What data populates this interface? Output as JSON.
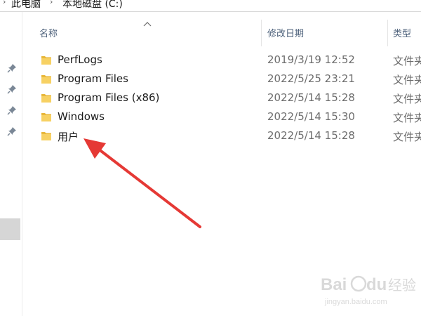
{
  "breadcrumb": {
    "items": [
      "此电脑",
      "本地磁盘 (C:)"
    ]
  },
  "columns": {
    "name": "名称",
    "modified": "修改日期",
    "type": "类型"
  },
  "files": [
    {
      "name": "PerfLogs",
      "date": "2019/3/19 12:52",
      "type": "文件夹"
    },
    {
      "name": "Program Files",
      "date": "2022/5/25 23:21",
      "type": "文件夹"
    },
    {
      "name": "Program Files (x86)",
      "date": "2022/5/14 15:28",
      "type": "文件夹"
    },
    {
      "name": "Windows",
      "date": "2022/5/14 15:30",
      "type": "文件夹"
    },
    {
      "name": "用户",
      "date": "2022/5/14 15:28",
      "type": "文件夹"
    }
  ],
  "icons": {
    "folder": "folder-icon",
    "pin": "pin-icon",
    "sort": "sort-ascending-icon",
    "breadcrumb_separator": "chevron-right-icon"
  },
  "colors": {
    "folder": "#f5c542",
    "header_text": "#4c607a",
    "annotation_arrow": "#e53935",
    "selection": "#d6d6d6"
  },
  "watermark": {
    "brand": "Bai du",
    "cn": "经验",
    "url": "jingyan.baidu.com"
  }
}
